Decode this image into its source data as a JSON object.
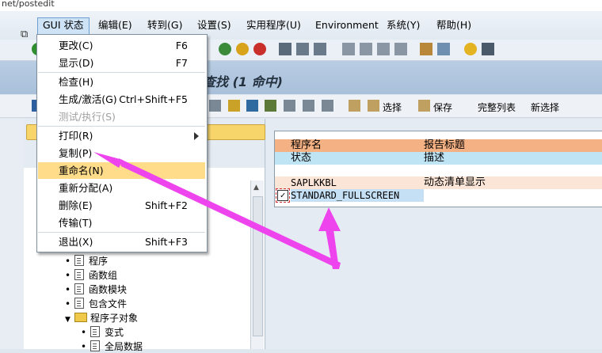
{
  "url_fragment": "net/postedit",
  "menubar": {
    "items": [
      {
        "label": "GUI 状态"
      },
      {
        "label": "编辑(E)"
      },
      {
        "label": "转到(G)"
      },
      {
        "label": "设置(S)"
      },
      {
        "label": "实用程序(U)"
      },
      {
        "label": "Environment"
      },
      {
        "label": "系统(Y)"
      },
      {
        "label": "帮助(H)"
      }
    ]
  },
  "title": "查找 (1 命中)",
  "toolbar2": {
    "select_label": "选择",
    "save_label": "保存",
    "full_list_label": "完整列表",
    "new_select_label": "新选择"
  },
  "dropdown": {
    "items": [
      {
        "label": "更改(C)",
        "shortcut": "F6"
      },
      {
        "label": "显示(D)",
        "shortcut": "F7"
      },
      {
        "label": "检查(H)",
        "shortcut": ""
      },
      {
        "label": "生成/激活(G)",
        "shortcut": "Ctrl+Shift+F5"
      },
      {
        "label": "测试/执行(S)",
        "shortcut": ""
      },
      {
        "label": "打印(R)",
        "shortcut": ""
      },
      {
        "label": "复制(P)",
        "shortcut": ""
      },
      {
        "label": "重命名(N)",
        "shortcut": ""
      },
      {
        "label": "重新分配(A)",
        "shortcut": ""
      },
      {
        "label": "删除(E)",
        "shortcut": "Shift+F2"
      },
      {
        "label": "传输(T)",
        "shortcut": ""
      },
      {
        "label": "退出(X)",
        "shortcut": "Shift+F3"
      }
    ]
  },
  "tree": {
    "items": [
      {
        "label": "程序"
      },
      {
        "label": "函数组"
      },
      {
        "label": "函数模块"
      },
      {
        "label": "包含文件"
      },
      {
        "label": "程序子对象"
      },
      {
        "label": "变式"
      },
      {
        "label": "全局数据"
      }
    ]
  },
  "results": {
    "header1": {
      "col1": "程序名",
      "col2": "报告标题"
    },
    "header2": {
      "col1": "状态",
      "col2": "描述"
    },
    "rows": [
      {
        "col1": "SAPLKKBL",
        "col2": "动态清单显示"
      },
      {
        "col1": "STANDARD_FULLSCREEN",
        "col2": ""
      }
    ]
  },
  "colors": {
    "header_orange": "#f4b183",
    "header_blue": "#bfe4f4",
    "row_peach": "#fbe5d6",
    "row_selected": "#c5e0f5",
    "annotation_magenta": "#ee44ee"
  }
}
